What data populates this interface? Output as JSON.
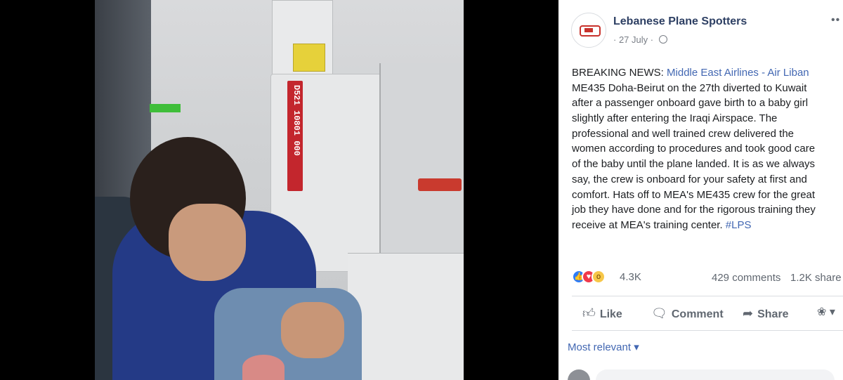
{
  "post": {
    "page_name": "Lebanese Plane Spotters",
    "date": "27 July",
    "text_lines": [
      {
        "prefix": "BREAKING NEWS: ",
        "link": "Middle East Airlines - Air Liban"
      },
      {
        "text": "ME435 Doha-Beirut on the 27th diverted to Kuwait"
      },
      {
        "text": "after a passenger onboard gave birth to a baby girl"
      },
      {
        "text": "slightly after entering the Iraqi Airspace. The"
      },
      {
        "text": "professional and well trained crew delivered the"
      },
      {
        "text": "women according to procedures and took good care"
      },
      {
        "text": "of the baby until the plane landed. It is as we always"
      },
      {
        "text": "say, the crew is onboard for your safety at first and"
      },
      {
        "text": "comfort. Hats off to MEA's ME435 crew for the great"
      },
      {
        "text": "job they have done and for the rigorous training they"
      },
      {
        "prefix": "receive at MEA's training center. ",
        "link": "#LPS"
      }
    ]
  },
  "photo": {
    "strap_text": "D521 10801 000"
  },
  "stats": {
    "reactions": "4.3K",
    "comments": "429 comments",
    "shares": "1.2K share"
  },
  "actions": {
    "like": "Like",
    "comment": "Comment",
    "share": "Share"
  },
  "sort": {
    "label": "Most relevant ▾"
  },
  "icons": {
    "like_icon": "thumbs-up",
    "comment_icon": "speech-bubble",
    "share_icon": "share-arrow",
    "globe_icon": "globe"
  },
  "colors": {
    "link": "#4267b2",
    "page_name": "#2d3f63",
    "like": "#2d7cf6",
    "love": "#f0384b",
    "wow": "#f7c748"
  }
}
